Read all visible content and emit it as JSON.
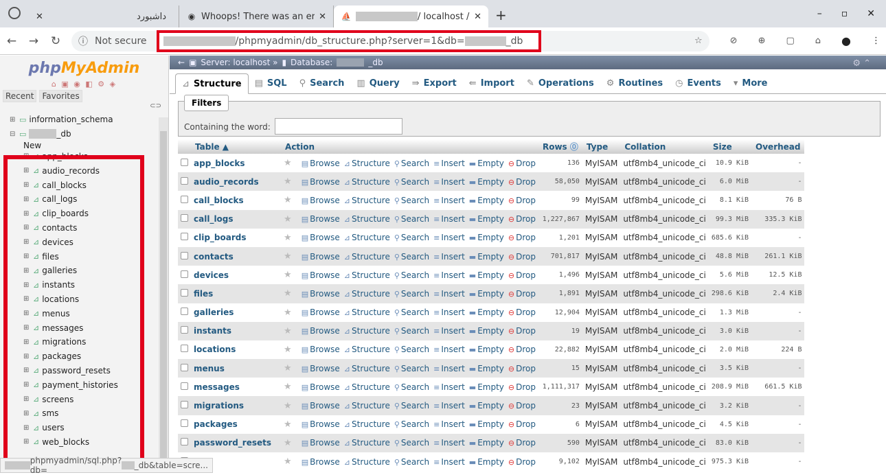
{
  "browser": {
    "tabs": [
      {
        "title": "داشبورد",
        "icon": "app-icon"
      },
      {
        "title": "Whoops! There was an error.",
        "icon": "globe-icon"
      },
      {
        "title": "/ localhost / s",
        "icon": "phpmyadmin-icon"
      }
    ],
    "new_tab": "+",
    "not_secure": "Not secure",
    "url": "/phpmyadmin/db_structure.php?server=1&db=",
    "url_suffix": "_db",
    "status_url": "phpmyadmin/sql.php?db=",
    "status_suffix": "_db&table=scre..."
  },
  "sidebar": {
    "logo_php": "php",
    "logo_my": "MyAdmin",
    "recent": "Recent",
    "favorites": "Favorites",
    "schema": "information_schema",
    "db_suffix": "_db",
    "new": "New",
    "items": [
      "app_blocks",
      "audio_records",
      "call_blocks",
      "call_logs",
      "clip_boards",
      "contacts",
      "devices",
      "files",
      "galleries",
      "instants",
      "locations",
      "menus",
      "messages",
      "migrations",
      "packages",
      "password_resets",
      "payment_histories",
      "screens",
      "sms",
      "users",
      "web_blocks"
    ]
  },
  "breadcrumb": {
    "server": "Server: localhost »",
    "database": "Database:",
    "db_suffix": "_db"
  },
  "tabs": [
    {
      "label": "Structure",
      "icon": "structure-icon"
    },
    {
      "label": "SQL",
      "icon": "sql-icon"
    },
    {
      "label": "Search",
      "icon": "search-icon"
    },
    {
      "label": "Query",
      "icon": "query-icon"
    },
    {
      "label": "Export",
      "icon": "export-icon"
    },
    {
      "label": "Import",
      "icon": "import-icon"
    },
    {
      "label": "Operations",
      "icon": "operations-icon"
    },
    {
      "label": "Routines",
      "icon": "routines-icon"
    },
    {
      "label": "Events",
      "icon": "events-icon"
    },
    {
      "label": "More",
      "icon": "more-icon"
    }
  ],
  "filters": {
    "legend": "Filters",
    "label": "Containing the word:"
  },
  "table": {
    "headers": {
      "table": "Table ▲",
      "action": "Action",
      "rows": "Rows",
      "type": "Type",
      "collation": "Collation",
      "size": "Size",
      "overhead": "Overhead"
    },
    "actions": {
      "browse": "Browse",
      "structure": "Structure",
      "search": "Search",
      "insert": "Insert",
      "empty": "Empty",
      "drop": "Drop"
    },
    "rows": [
      {
        "name": "app_blocks",
        "rows": "136",
        "type": "MyISAM",
        "collation": "utf8mb4_unicode_ci",
        "size": "10.9 KiB",
        "overhead": "-"
      },
      {
        "name": "audio_records",
        "rows": "58,050",
        "type": "MyISAM",
        "collation": "utf8mb4_unicode_ci",
        "size": "6.0 MiB",
        "overhead": "-"
      },
      {
        "name": "call_blocks",
        "rows": "99",
        "type": "MyISAM",
        "collation": "utf8mb4_unicode_ci",
        "size": "8.1 KiB",
        "overhead": "76 B"
      },
      {
        "name": "call_logs",
        "rows": "1,227,867",
        "type": "MyISAM",
        "collation": "utf8mb4_unicode_ci",
        "size": "99.3 MiB",
        "overhead": "335.3 KiB"
      },
      {
        "name": "clip_boards",
        "rows": "1,201",
        "type": "MyISAM",
        "collation": "utf8mb4_unicode_ci",
        "size": "685.6 KiB",
        "overhead": "-"
      },
      {
        "name": "contacts",
        "rows": "701,817",
        "type": "MyISAM",
        "collation": "utf8mb4_unicode_ci",
        "size": "48.8 MiB",
        "overhead": "261.1 KiB"
      },
      {
        "name": "devices",
        "rows": "1,496",
        "type": "MyISAM",
        "collation": "utf8mb4_unicode_ci",
        "size": "5.6 MiB",
        "overhead": "12.5 KiB"
      },
      {
        "name": "files",
        "rows": "1,891",
        "type": "MyISAM",
        "collation": "utf8mb4_unicode_ci",
        "size": "298.6 KiB",
        "overhead": "2.4 KiB"
      },
      {
        "name": "galleries",
        "rows": "12,904",
        "type": "MyISAM",
        "collation": "utf8mb4_unicode_ci",
        "size": "1.3 MiB",
        "overhead": "-"
      },
      {
        "name": "instants",
        "rows": "19",
        "type": "MyISAM",
        "collation": "utf8mb4_unicode_ci",
        "size": "3.0 KiB",
        "overhead": "-"
      },
      {
        "name": "locations",
        "rows": "22,882",
        "type": "MyISAM",
        "collation": "utf8mb4_unicode_ci",
        "size": "2.0 MiB",
        "overhead": "224 B"
      },
      {
        "name": "menus",
        "rows": "15",
        "type": "MyISAM",
        "collation": "utf8mb4_unicode_ci",
        "size": "3.5 KiB",
        "overhead": "-"
      },
      {
        "name": "messages",
        "rows": "1,111,317",
        "type": "MyISAM",
        "collation": "utf8mb4_unicode_ci",
        "size": "208.9 MiB",
        "overhead": "661.5 KiB"
      },
      {
        "name": "migrations",
        "rows": "23",
        "type": "MyISAM",
        "collation": "utf8mb4_unicode_ci",
        "size": "3.2 KiB",
        "overhead": "-"
      },
      {
        "name": "packages",
        "rows": "6",
        "type": "MyISAM",
        "collation": "utf8mb4_unicode_ci",
        "size": "4.5 KiB",
        "overhead": "-"
      },
      {
        "name": "password_resets",
        "rows": "590",
        "type": "MyISAM",
        "collation": "utf8mb4_unicode_ci",
        "size": "83.0 KiB",
        "overhead": "-"
      },
      {
        "name": "",
        "rows": "9,102",
        "type": "MyISAM",
        "collation": "utf8mb4_unicode_ci",
        "size": "975.3 KiB",
        "overhead": "-"
      }
    ]
  }
}
